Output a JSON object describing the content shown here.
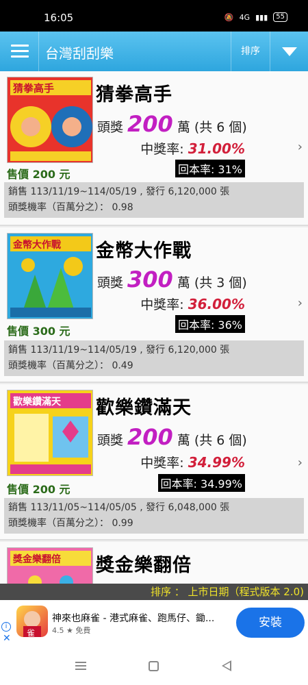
{
  "status_bar": {
    "time": "16:05",
    "network": "4G",
    "battery": "55"
  },
  "app_bar": {
    "title": "台灣刮刮樂",
    "sort_label": "排序"
  },
  "tickets": [
    {
      "name": "猜拳高手",
      "price": "售價 200 元",
      "prize_prefix": "頭獎",
      "prize_amount": "200",
      "prize_suffix": "萬 (共 6 個)",
      "win_label": "中獎率:",
      "win_rate": "31.00%",
      "return_rate": "回本率: 31%",
      "sales": "銷售 113/11/19~114/05/19 , 發行 6,120,000 張",
      "odds": "頭獎機率（百萬分之）： 0.98",
      "thumb_title": "猜拳高手",
      "thumb_colors": [
        "#e8332b",
        "#f6d026",
        "#1f6fb8"
      ]
    },
    {
      "name": "金幣大作戰",
      "price": "售價 300 元",
      "prize_prefix": "頭獎",
      "prize_amount": "300",
      "prize_suffix": "萬 (共 3 個)",
      "win_label": "中獎率:",
      "win_rate": "36.00%",
      "return_rate": "回本率: 36%",
      "sales": "銷售 113/11/19~114/05/19 , 發行 6,120,000 張",
      "odds": "頭獎機率（百萬分之）： 0.49",
      "thumb_title": "金幣大作戰",
      "thumb_colors": [
        "#2ea9df",
        "#f3c919",
        "#3aa83a"
      ]
    },
    {
      "name": "歡樂鑽滿天",
      "price": "售價 200 元",
      "prize_prefix": "頭獎",
      "prize_amount": "200",
      "prize_suffix": "萬 (共 6 個)",
      "win_label": "中獎率:",
      "win_rate": "34.99%",
      "return_rate": "回本率: 34.99%",
      "sales": "銷售 113/11/05~114/05/05 , 發行 6,048,000 張",
      "odds": "頭獎機率（百萬分之）： 0.99",
      "thumb_title": "歡樂鑽滿天",
      "thumb_colors": [
        "#f6d21a",
        "#6fc3ef",
        "#e43c8a"
      ]
    },
    {
      "name": "獎金樂翻倍",
      "thumb_title": "獎金樂翻倍",
      "thumb_colors": [
        "#f06aa8",
        "#f7dc3a",
        "#3bb0e6"
      ]
    }
  ],
  "sort_footer": "排序 ： 上市日期（程式版本 2.0)",
  "ad": {
    "title": "神來也麻雀 - 港式麻雀、跑馬仔、鋤...",
    "rating": "4.5 ★ 免費",
    "install_label": "安裝",
    "icon_text": "雀"
  }
}
